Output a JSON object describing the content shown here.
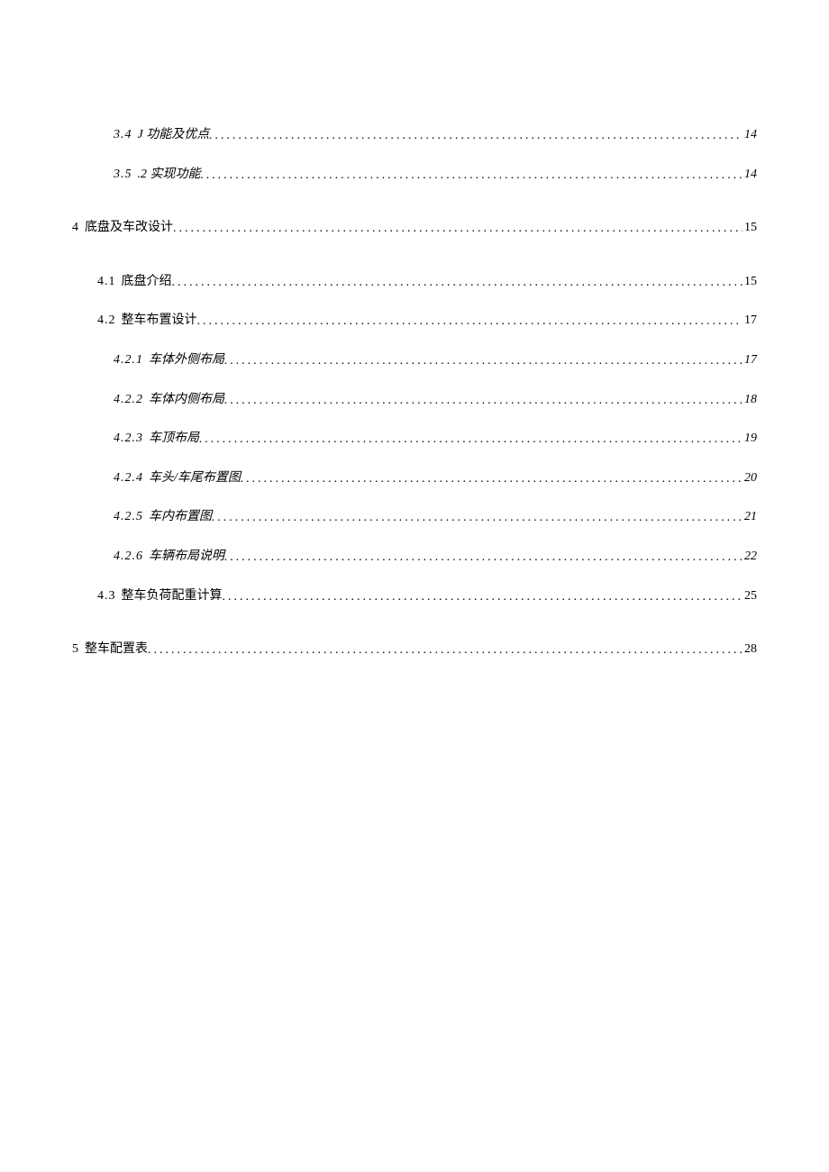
{
  "toc": {
    "entries": [
      {
        "level": 3,
        "italic": true,
        "num": "3.4",
        "title": "J 功能及优点",
        "page": "14",
        "extraClass": ""
      },
      {
        "level": 3,
        "italic": true,
        "num": "3.5",
        "title": ".2 实现功能",
        "page": "14",
        "extraClass": ""
      },
      {
        "level": 1,
        "italic": false,
        "num": "4",
        "title": "底盘及车改设计",
        "page": "15",
        "extraClass": "toc-gap-before"
      },
      {
        "level": 2,
        "italic": false,
        "num": "4.1",
        "title": "底盘介绍",
        "page": "15",
        "extraClass": "toc-gap-before"
      },
      {
        "level": 2,
        "italic": false,
        "num": "4.2",
        "title": "整车布置设计",
        "page": "17",
        "extraClass": ""
      },
      {
        "level": 3,
        "italic": true,
        "num": "4.2.1",
        "title": "车体外侧布局",
        "page": "17",
        "extraClass": ""
      },
      {
        "level": 3,
        "italic": true,
        "num": "4.2.2",
        "title": "车体内侧布局",
        "page": "18",
        "extraClass": ""
      },
      {
        "level": 3,
        "italic": true,
        "num": "4.2.3",
        "title": "车顶布局",
        "page": "19",
        "extraClass": ""
      },
      {
        "level": 3,
        "italic": true,
        "num": "4.2.4",
        "title": "车头/车尾布置图",
        "page": "20",
        "extraClass": ""
      },
      {
        "level": 3,
        "italic": true,
        "num": "4.2.5",
        "title": "车内布置图",
        "page": "21",
        "extraClass": ""
      },
      {
        "level": 3,
        "italic": true,
        "num": "4.2.6",
        "title": "车辆布局说明",
        "page": "22",
        "extraClass": ""
      },
      {
        "level": 2,
        "italic": false,
        "num": "4.3",
        "title": "整车负荷配重计算",
        "page": "25",
        "extraClass": ""
      },
      {
        "level": 1,
        "italic": false,
        "num": "5",
        "title": "整车配置表",
        "page": "28",
        "extraClass": "toc-gap-before"
      }
    ]
  }
}
